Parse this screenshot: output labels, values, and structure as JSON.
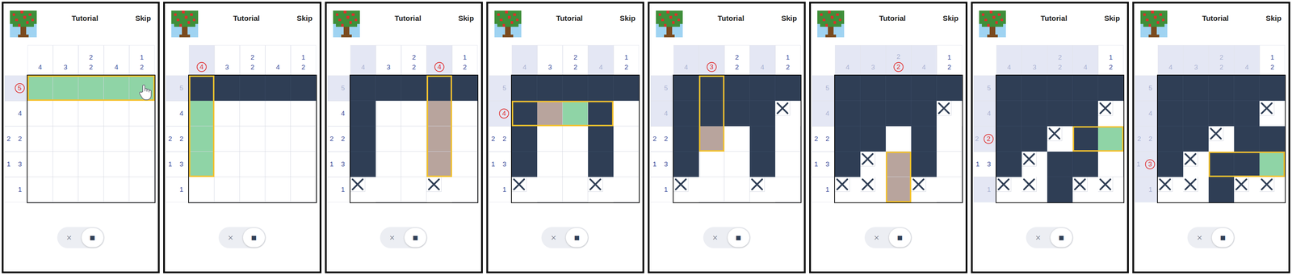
{
  "chrome": {
    "title": "Tutorial",
    "skip": "Skip",
    "toggle": [
      {
        "label": "×",
        "selected": false
      },
      {
        "label": "■",
        "selected": true
      }
    ]
  },
  "panels": [
    {
      "col_clues": [
        [
          {
            "text": "4",
            "done": false,
            "circled": false
          }
        ],
        [
          {
            "text": "3",
            "done": false,
            "circled": false
          }
        ],
        [
          {
            "text": "2",
            "done": false,
            "circled": false
          },
          {
            "text": "2",
            "done": false,
            "circled": false
          }
        ],
        [
          {
            "text": "4",
            "done": false,
            "circled": false
          }
        ],
        [
          {
            "text": "1",
            "done": false,
            "circled": false
          },
          {
            "text": "2",
            "done": false,
            "circled": false
          }
        ]
      ],
      "row_clues": [
        [
          {
            "text": "5",
            "done": false,
            "circled": true
          }
        ],
        [
          {
            "text": "4",
            "done": false,
            "circled": false
          }
        ],
        [
          {
            "text": "2",
            "done": false,
            "circled": false
          },
          {
            "text": "2",
            "done": false,
            "circled": false
          }
        ],
        [
          {
            "text": "1",
            "done": false,
            "circled": false
          },
          {
            "text": "3",
            "done": false,
            "circled": false
          }
        ],
        [
          {
            "text": "1",
            "done": false,
            "circled": false
          }
        ]
      ],
      "cells": [
        "ggggg",
        ".....",
        ".....",
        ".....",
        "....."
      ],
      "highlight": {
        "axis": "row",
        "index": 0,
        "from": 0,
        "to": 4
      },
      "pointer": true
    },
    {
      "col_clues": [
        [
          {
            "text": "4",
            "done": false,
            "circled": true
          }
        ],
        [
          {
            "text": "3",
            "done": false,
            "circled": false
          }
        ],
        [
          {
            "text": "2",
            "done": false,
            "circled": false
          },
          {
            "text": "2",
            "done": false,
            "circled": false
          }
        ],
        [
          {
            "text": "4",
            "done": false,
            "circled": false
          }
        ],
        [
          {
            "text": "1",
            "done": false,
            "circled": false
          },
          {
            "text": "2",
            "done": false,
            "circled": false
          }
        ]
      ],
      "row_clues": [
        [
          {
            "text": "5",
            "done": true,
            "circled": false
          }
        ],
        [
          {
            "text": "4",
            "done": false,
            "circled": false
          }
        ],
        [
          {
            "text": "2",
            "done": false,
            "circled": false
          },
          {
            "text": "2",
            "done": false,
            "circled": false
          }
        ],
        [
          {
            "text": "1",
            "done": false,
            "circled": false
          },
          {
            "text": "3",
            "done": false,
            "circled": false
          }
        ],
        [
          {
            "text": "1",
            "done": false,
            "circled": false
          }
        ]
      ],
      "cells": [
        "fffff",
        "g....",
        "g....",
        "g....",
        "....."
      ],
      "highlight": {
        "axis": "col",
        "index": 0,
        "from": 0,
        "to": 3
      },
      "pointer": false
    },
    {
      "col_clues": [
        [
          {
            "text": "4",
            "done": true,
            "circled": false
          }
        ],
        [
          {
            "text": "3",
            "done": false,
            "circled": false
          }
        ],
        [
          {
            "text": "2",
            "done": false,
            "circled": false
          },
          {
            "text": "2",
            "done": false,
            "circled": false
          }
        ],
        [
          {
            "text": "4",
            "done": false,
            "circled": true
          }
        ],
        [
          {
            "text": "1",
            "done": false,
            "circled": false
          },
          {
            "text": "2",
            "done": false,
            "circled": false
          }
        ]
      ],
      "row_clues": [
        [
          {
            "text": "5",
            "done": true,
            "circled": false
          }
        ],
        [
          {
            "text": "4",
            "done": false,
            "circled": false
          }
        ],
        [
          {
            "text": "2",
            "done": false,
            "circled": false
          },
          {
            "text": "2",
            "done": false,
            "circled": false
          }
        ],
        [
          {
            "text": "1",
            "done": false,
            "circled": false
          },
          {
            "text": "3",
            "done": false,
            "circled": false
          }
        ],
        [
          {
            "text": "1",
            "done": false,
            "circled": false
          }
        ]
      ],
      "cells": [
        "fffff",
        "f..t.",
        "f..t.",
        "f..t.",
        "x..x."
      ],
      "highlight": {
        "axis": "col",
        "index": 3,
        "from": 0,
        "to": 3
      },
      "pointer": false
    },
    {
      "col_clues": [
        [
          {
            "text": "4",
            "done": true,
            "circled": false
          }
        ],
        [
          {
            "text": "3",
            "done": false,
            "circled": false
          }
        ],
        [
          {
            "text": "2",
            "done": false,
            "circled": false
          },
          {
            "text": "2",
            "done": false,
            "circled": false
          }
        ],
        [
          {
            "text": "4",
            "done": true,
            "circled": false
          }
        ],
        [
          {
            "text": "1",
            "done": false,
            "circled": false
          },
          {
            "text": "2",
            "done": false,
            "circled": false
          }
        ]
      ],
      "row_clues": [
        [
          {
            "text": "5",
            "done": true,
            "circled": false
          }
        ],
        [
          {
            "text": "4",
            "done": false,
            "circled": true
          }
        ],
        [
          {
            "text": "2",
            "done": false,
            "circled": false
          },
          {
            "text": "2",
            "done": false,
            "circled": false
          }
        ],
        [
          {
            "text": "1",
            "done": false,
            "circled": false
          },
          {
            "text": "3",
            "done": false,
            "circled": false
          }
        ],
        [
          {
            "text": "1",
            "done": false,
            "circled": false
          }
        ]
      ],
      "cells": [
        "fffff",
        "ftgf.",
        "f..f.",
        "f..f.",
        "x..x."
      ],
      "highlight": {
        "axis": "row",
        "index": 1,
        "from": 0,
        "to": 3
      },
      "pointer": false
    },
    {
      "col_clues": [
        [
          {
            "text": "4",
            "done": true,
            "circled": false
          }
        ],
        [
          {
            "text": "3",
            "done": false,
            "circled": true
          }
        ],
        [
          {
            "text": "2",
            "done": false,
            "circled": false
          },
          {
            "text": "2",
            "done": false,
            "circled": false
          }
        ],
        [
          {
            "text": "4",
            "done": true,
            "circled": false
          }
        ],
        [
          {
            "text": "1",
            "done": false,
            "circled": false
          },
          {
            "text": "2",
            "done": false,
            "circled": false
          }
        ]
      ],
      "row_clues": [
        [
          {
            "text": "5",
            "done": true,
            "circled": false
          }
        ],
        [
          {
            "text": "4",
            "done": true,
            "circled": false
          }
        ],
        [
          {
            "text": "2",
            "done": false,
            "circled": false
          },
          {
            "text": "2",
            "done": false,
            "circled": false
          }
        ],
        [
          {
            "text": "1",
            "done": false,
            "circled": false
          },
          {
            "text": "3",
            "done": false,
            "circled": false
          }
        ],
        [
          {
            "text": "1",
            "done": false,
            "circled": false
          }
        ]
      ],
      "cells": [
        "fffff",
        "ffffx",
        "ft.f.",
        "f..f.",
        "x..x."
      ],
      "highlight": {
        "axis": "col",
        "index": 1,
        "from": 0,
        "to": 2
      },
      "pointer": false
    },
    {
      "col_clues": [
        [
          {
            "text": "4",
            "done": true,
            "circled": false
          }
        ],
        [
          {
            "text": "3",
            "done": true,
            "circled": false
          }
        ],
        [
          {
            "text": "2",
            "done": true,
            "circled": false
          },
          {
            "text": "2",
            "done": false,
            "circled": true
          }
        ],
        [
          {
            "text": "4",
            "done": true,
            "circled": false
          }
        ],
        [
          {
            "text": "1",
            "done": false,
            "circled": false
          },
          {
            "text": "2",
            "done": false,
            "circled": false
          }
        ]
      ],
      "row_clues": [
        [
          {
            "text": "5",
            "done": true,
            "circled": false
          }
        ],
        [
          {
            "text": "4",
            "done": true,
            "circled": false
          }
        ],
        [
          {
            "text": "2",
            "done": false,
            "circled": false
          },
          {
            "text": "2",
            "done": false,
            "circled": false
          }
        ],
        [
          {
            "text": "1",
            "done": false,
            "circled": false
          },
          {
            "text": "3",
            "done": false,
            "circled": false
          }
        ],
        [
          {
            "text": "1",
            "done": false,
            "circled": false
          }
        ]
      ],
      "cells": [
        "fffff",
        "ffffx",
        "ff.f.",
        "fxtf.",
        "xxtx."
      ],
      "highlight": {
        "axis": "col",
        "index": 2,
        "from": 3,
        "to": 4
      },
      "pointer": false
    },
    {
      "col_clues": [
        [
          {
            "text": "4",
            "done": true,
            "circled": false
          }
        ],
        [
          {
            "text": "3",
            "done": true,
            "circled": false
          }
        ],
        [
          {
            "text": "2",
            "done": true,
            "circled": false
          },
          {
            "text": "2",
            "done": true,
            "circled": false
          }
        ],
        [
          {
            "text": "4",
            "done": true,
            "circled": false
          }
        ],
        [
          {
            "text": "1",
            "done": false,
            "circled": false
          },
          {
            "text": "2",
            "done": false,
            "circled": false
          }
        ]
      ],
      "row_clues": [
        [
          {
            "text": "5",
            "done": true,
            "circled": false
          }
        ],
        [
          {
            "text": "4",
            "done": true,
            "circled": false
          }
        ],
        [
          {
            "text": "2",
            "done": true,
            "circled": false
          },
          {
            "text": "2",
            "done": false,
            "circled": true
          }
        ],
        [
          {
            "text": "1",
            "done": false,
            "circled": false
          },
          {
            "text": "3",
            "done": false,
            "circled": false
          }
        ],
        [
          {
            "text": "1",
            "done": true,
            "circled": false
          }
        ]
      ],
      "cells": [
        "fffff",
        "ffffx",
        "ffxfg",
        "fxff.",
        "xxfxx"
      ],
      "highlight": {
        "axis": "row",
        "index": 2,
        "from": 3,
        "to": 4
      },
      "pointer": false
    },
    {
      "col_clues": [
        [
          {
            "text": "4",
            "done": true,
            "circled": false
          }
        ],
        [
          {
            "text": "3",
            "done": true,
            "circled": false
          }
        ],
        [
          {
            "text": "2",
            "done": true,
            "circled": false
          },
          {
            "text": "2",
            "done": true,
            "circled": false
          }
        ],
        [
          {
            "text": "4",
            "done": true,
            "circled": false
          }
        ],
        [
          {
            "text": "1",
            "done": false,
            "circled": false
          },
          {
            "text": "2",
            "done": false,
            "circled": false
          }
        ]
      ],
      "row_clues": [
        [
          {
            "text": "5",
            "done": true,
            "circled": false
          }
        ],
        [
          {
            "text": "4",
            "done": true,
            "circled": false
          }
        ],
        [
          {
            "text": "2",
            "done": true,
            "circled": false
          },
          {
            "text": "2",
            "done": true,
            "circled": false
          }
        ],
        [
          {
            "text": "1",
            "done": true,
            "circled": false
          },
          {
            "text": "3",
            "done": false,
            "circled": true
          }
        ],
        [
          {
            "text": "1",
            "done": true,
            "circled": false
          }
        ]
      ],
      "cells": [
        "fffff",
        "ffffx",
        "ffxff",
        "fxffg",
        "xxfxx"
      ],
      "highlight": {
        "axis": "row",
        "index": 3,
        "from": 2,
        "to": 4
      },
      "pointer": false
    }
  ]
}
